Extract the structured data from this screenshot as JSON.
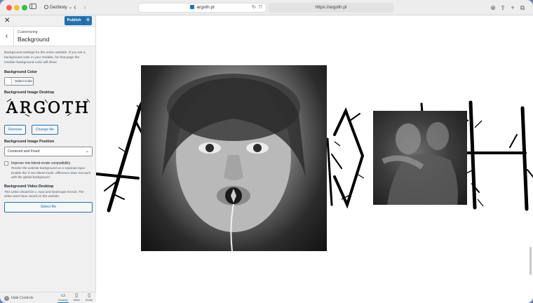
{
  "browser": {
    "profile_label": "Dezbisty",
    "tab_title": "argoth.pl",
    "url": "https://argoth.pl"
  },
  "customizer": {
    "close_glyph": "✕",
    "publish_label": "Publish",
    "breadcrumb": "Customizing",
    "section_title": "Background",
    "description": "Background settings for the entire website. If you set a background color in your Gridder, for that page the Gridder background color will show.",
    "background_color": {
      "label": "Background Color",
      "button_label": "Select Color"
    },
    "background_image_desktop": {
      "label": "Background Image Desktop",
      "logo_text": "ARGOTH",
      "remove_label": "Remove",
      "change_label": "Change file"
    },
    "background_image_position": {
      "label": "Background Image Position",
      "selected": "Centered and Fixed"
    },
    "mix_blend": {
      "label": "Improve mix-blend-mode compatibility",
      "description": "Render the website background as a separate layer. Enable this if mix-blend-mode: difference does not work with the global background"
    },
    "background_video_desktop": {
      "label": "Background Video Desktop",
      "description": "This video should be a .mp4 and landscape format. The video wont have sound on the website.",
      "button_label": "Select file"
    },
    "footer": {
      "hide_controls": "Hide Controls",
      "devices": [
        {
          "label": "Desktop",
          "icon": "desktop-icon"
        },
        {
          "label": "Tablet",
          "icon": "tablet-icon"
        },
        {
          "label": "Mobile",
          "icon": "mobile-icon"
        }
      ]
    }
  },
  "preview": {
    "logo_text": "ARGOTH",
    "colors": {
      "publish_blue": "#2271b1",
      "ink": "#000000"
    }
  }
}
